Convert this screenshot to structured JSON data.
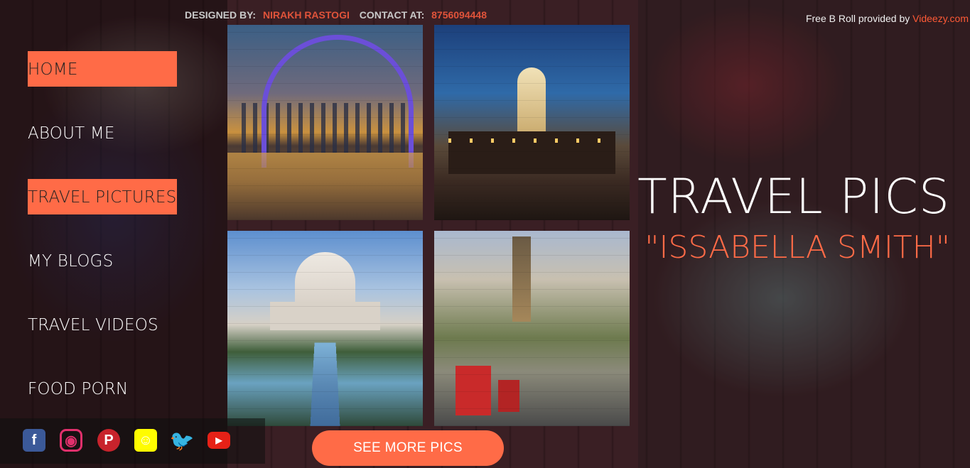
{
  "topbar": {
    "designed_label": "DESIGNED BY:",
    "designer": "NIRAKH RASTOGI",
    "contact_label": "CONTACT AT:",
    "contact": "8756094448"
  },
  "credit": {
    "text": "Free B Roll provided by ",
    "link": "Videezy.com"
  },
  "nav": {
    "items": [
      {
        "label": "HOME"
      },
      {
        "label": "ABOUT ME"
      },
      {
        "label": "TRAVEL PICTURES"
      },
      {
        "label": "MY BLOGS"
      },
      {
        "label": "TRAVEL VIDEOS"
      },
      {
        "label": "FOOD PORN"
      }
    ]
  },
  "hero": {
    "title": "TRAVEL PICS",
    "subtitle": "\"ISSABELLA SMITH\""
  },
  "social": {
    "icons": [
      "facebook-icon",
      "instagram-icon",
      "pinterest-icon",
      "snapchat-icon",
      "twitter-icon",
      "youtube-icon"
    ]
  },
  "cta": {
    "label": "SEE MORE PICS"
  },
  "colors": {
    "accent": "#ff6b47",
    "designer": "#e0533a"
  }
}
